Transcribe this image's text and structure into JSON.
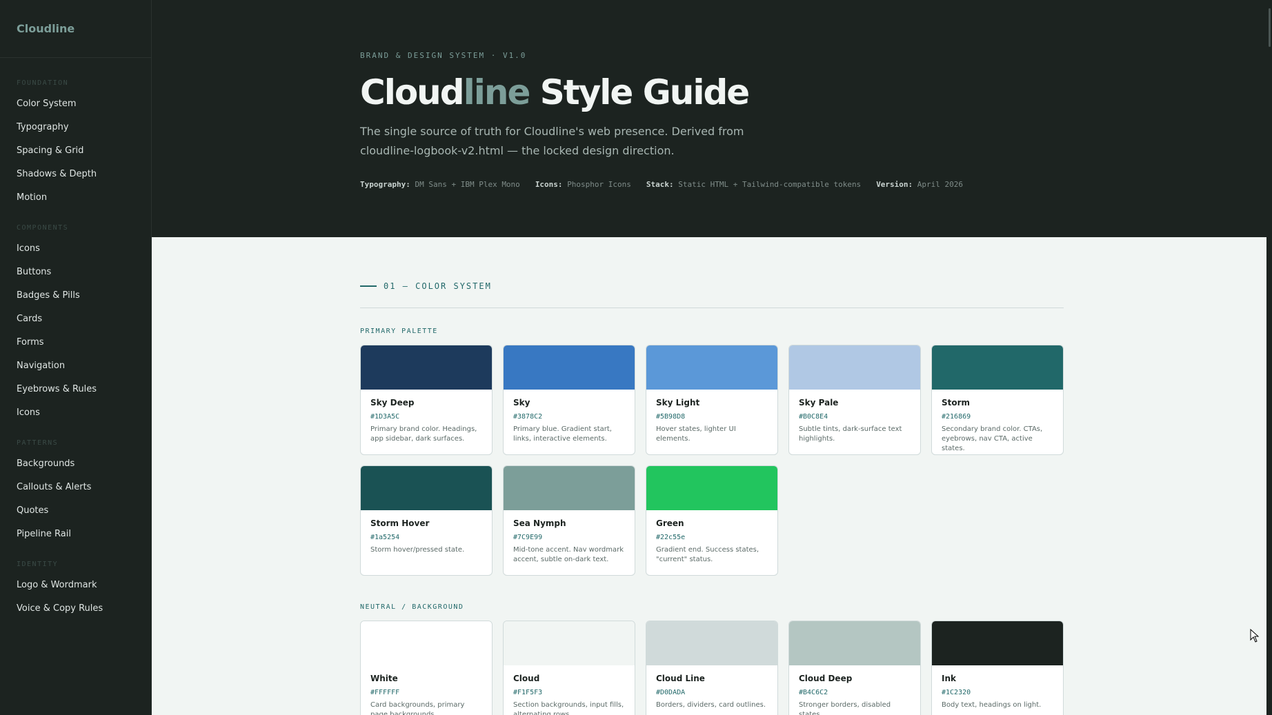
{
  "sidebar": {
    "brand": "Cloudline",
    "groups": [
      {
        "head": "FOUNDATION",
        "items": [
          "Color System",
          "Typography",
          "Spacing & Grid",
          "Shadows & Depth",
          "Motion"
        ]
      },
      {
        "head": "COMPONENTS",
        "items": [
          "Icons",
          "Buttons",
          "Badges & Pills",
          "Cards",
          "Forms",
          "Navigation",
          "Eyebrows & Rules",
          "Icons"
        ]
      },
      {
        "head": "PATTERNS",
        "items": [
          "Backgrounds",
          "Callouts & Alerts",
          "Quotes",
          "Pipeline Rail"
        ]
      },
      {
        "head": "IDENTITY",
        "items": [
          "Logo & Wordmark",
          "Voice & Copy Rules"
        ]
      }
    ]
  },
  "hero": {
    "eyebrow": "BRAND & DESIGN SYSTEM · V1.0",
    "title_a": "Cloud",
    "title_b": "line",
    "title_c": " Style Guide",
    "lede": "The single source of truth for Cloudline's web presence. Derived from cloudline-logbook-v2.html — the locked design direction.",
    "meta": [
      {
        "k": "Typography:",
        "v": "DM Sans + IBM Plex Mono"
      },
      {
        "k": "Icons:",
        "v": "Phosphor Icons"
      },
      {
        "k": "Stack:",
        "v": "Static HTML + Tailwind-compatible tokens"
      },
      {
        "k": "Version:",
        "v": "April 2026"
      }
    ]
  },
  "section": {
    "title": "01 — COLOR SYSTEM",
    "primary_label": "PRIMARY PALETTE",
    "primary": [
      {
        "name": "Sky Deep",
        "hex": "#1D3A5C",
        "color": "#1D3A5C",
        "desc": "Primary brand color. Headings, app sidebar, dark surfaces."
      },
      {
        "name": "Sky",
        "hex": "#3878C2",
        "color": "#3878C2",
        "desc": "Primary blue. Gradient start, links, interactive elements."
      },
      {
        "name": "Sky Light",
        "hex": "#5B98D8",
        "color": "#5B98D8",
        "desc": "Hover states, lighter UI elements."
      },
      {
        "name": "Sky Pale",
        "hex": "#B0C8E4",
        "color": "#B0C8E4",
        "desc": "Subtle tints, dark-surface text highlights."
      },
      {
        "name": "Storm",
        "hex": "#216869",
        "color": "#216869",
        "desc": "Secondary brand color. CTAs, eyebrows, nav CTA, active states."
      },
      {
        "name": "Storm Hover",
        "hex": "#1a5254",
        "color": "#1a5254",
        "desc": "Storm hover/pressed state."
      },
      {
        "name": "Sea Nymph",
        "hex": "#7C9E99",
        "color": "#7C9E99",
        "desc": "Mid-tone accent. Nav wordmark accent, subtle on-dark text."
      },
      {
        "name": "Green",
        "hex": "#22c55e",
        "color": "#22c55e",
        "desc": "Gradient end. Success states, \"current\" status."
      }
    ],
    "neutral_label": "NEUTRAL / BACKGROUND",
    "neutral": [
      {
        "name": "White",
        "hex": "#FFFFFF",
        "color": "#FFFFFF",
        "desc": "Card backgrounds, primary page backgrounds."
      },
      {
        "name": "Cloud",
        "hex": "#F1F5F3",
        "color": "#F1F5F3",
        "desc": "Section backgrounds, input fills, alternating rows."
      },
      {
        "name": "Cloud Line",
        "hex": "#D0DADA",
        "color": "#D0DADA",
        "desc": "Borders, dividers, card outlines."
      },
      {
        "name": "Cloud Deep",
        "hex": "#B4C6C2",
        "color": "#B4C6C2",
        "desc": "Stronger borders, disabled states."
      },
      {
        "name": "Ink",
        "hex": "#1C2320",
        "color": "#1C2320",
        "desc": "Body text, headings on light."
      }
    ]
  }
}
